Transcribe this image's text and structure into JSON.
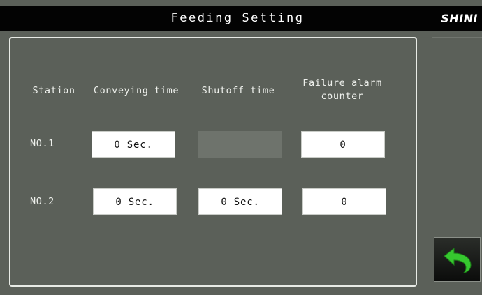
{
  "header": {
    "title": "Feeding Setting",
    "logo": "SHINI"
  },
  "columns": {
    "station": "Station",
    "conveying_time": "Conveying time",
    "shutoff_time": "Shutoff time",
    "failure_alarm_counter_line1": "Failure alarm",
    "failure_alarm_counter_line2": "counter"
  },
  "rows": [
    {
      "station": "NO.1",
      "conveying_time": "0 Sec.",
      "shutoff_time": "",
      "failure_alarm_counter": "0"
    },
    {
      "station": "NO.2",
      "conveying_time": "0 Sec.",
      "shutoff_time": "0 Sec.",
      "failure_alarm_counter": "0"
    }
  ],
  "back_button": {
    "icon": "return-arrow-icon",
    "color": "#36c82f"
  },
  "colors": {
    "background": "#5b6059",
    "titlebar": "#030303",
    "field": "#ffffff",
    "field_disabled": "#6e736c"
  }
}
